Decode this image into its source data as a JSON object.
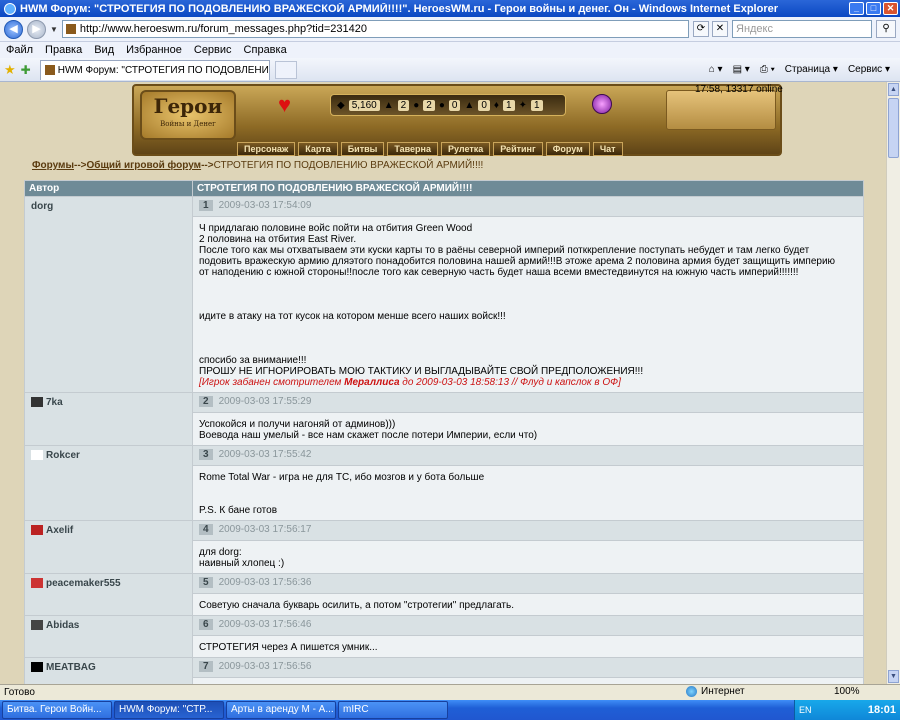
{
  "window": {
    "title": "HWM Форум: \"СТРОТЕГИЯ ПО ПОДОВЛЕНИЮ ВРАЖЕСКОЙ АРМИЙ!!!!\". HeroesWM.ru - Герои войны и денег. Он - Windows Internet Explorer"
  },
  "address": {
    "url": "http://www.heroeswm.ru/forum_messages.php?tid=231420",
    "search_placeholder": "Яндекс"
  },
  "menu": [
    "Файл",
    "Правка",
    "Вид",
    "Избранное",
    "Сервис",
    "Справка"
  ],
  "tab": {
    "title": "HWM Форум: \"СТРОТЕГИЯ ПО ПОДОВЛЕНИЮ ВРАЖ...",
    "cmd_page": "Страница",
    "cmd_tools": "Сервис"
  },
  "game": {
    "logo_main": "Герои",
    "logo_sub": "Войны и Денег",
    "clock": "17:58, 13317 online",
    "resources": [
      "5,160",
      "2",
      "2",
      "0",
      "0",
      "1",
      "1"
    ],
    "nav": [
      "Персонаж",
      "Карта",
      "Битвы",
      "Таверна",
      "Рулетка",
      "Рейтинг",
      "Форум",
      "Чат"
    ]
  },
  "breadcrumb": {
    "root": "Форумы",
    "sep1": "-->",
    "forum": "Общий игровой форум",
    "sep2": "-->",
    "topic": "СТРОТЕГИЯ ПО ПОДОВЛЕНИЮ ВРАЖЕСКОЙ АРМИЙ!!!!"
  },
  "table": {
    "col_author": "Автор",
    "col_topic": "СТРОТЕГИЯ ПО ПОДОВЛЕНИЮ ВРАЖЕСКОЙ АРМИЙ!!!!"
  },
  "posts": [
    {
      "author": "dorg",
      "num": "1",
      "date": "2009-03-03 17:54:09",
      "lines": [
        "Ч придлагаю половине войс пойти на отбития Green Wood",
        "2 половина на отбития East River.",
        "После того как мы отхватываем эти куски карты то в раёны северной империй потккрепление поступать небудет и там легко будет",
        "подовить вражескую армию дляэтого понадобится половина нашей армий!!!В этоже арема 2 половина армия будет защищить империю",
        "от наподению с южной стороны!!после того как северную часть будет наша всеми вместедвинутся на южную часть империй!!!!!!!",
        "",
        "",
        "",
        "идите в атаку на тот кусок на котором менше всего наших войск!!!",
        "",
        "",
        "",
        "спосибо за внимание!!!",
        "ПРОШУ НЕ ИГНОРИРОВАТЬ МОЮ ТАКТИКУ И ВЫГЛАДЫВАЙТЕ СВОЙ ПРЕДПОЛОЖЕНИЯ!!!"
      ],
      "ban_prefix": "[Игрок забанен смотрителем ",
      "ban_mod": "Мераллиса",
      "ban_suffix": " до 2009-03-03 18:58:13 // Флуд и капслок в ОФ]"
    },
    {
      "author": "7ka",
      "num": "2",
      "date": "2009-03-03 17:55:29",
      "lines": [
        "Успокойся и получи нагоняй от админов)))",
        "Воевода наш умелый - все нам скажет после потери Империи, если что)"
      ]
    },
    {
      "author": "Rokcer",
      "num": "3",
      "date": "2009-03-03 17:55:42",
      "lines": [
        "Rome Total War - игра не для ТС, ибо мозгов и у бота больше",
        "",
        "",
        "P.S. К бане готов"
      ]
    },
    {
      "author": "Axelif",
      "num": "4",
      "date": "2009-03-03 17:56:17",
      "lines": [
        "для dorg:",
        "наивный хлопец :)"
      ]
    },
    {
      "author": "peacemaker555",
      "num": "5",
      "date": "2009-03-03 17:56:36",
      "lines": [
        "Советую сначала букварь осилить, а потом \"стротегии\" предлагать."
      ]
    },
    {
      "author": "Abidas",
      "num": "6",
      "date": "2009-03-03 17:56:46",
      "lines": [
        "СТРОТЕГИЯ через А пишется умник..."
      ]
    },
    {
      "author": "MEATBAG",
      "num": "7",
      "date": "2009-03-03 17:56:56",
      "lines": []
    }
  ],
  "status": {
    "text": "Готово",
    "zone": "Интернет",
    "zoom": "100%"
  },
  "taskbar": {
    "tasks": [
      "Битва. Герои Войн...",
      "HWM Форум: \"СТР...",
      "Арты в аренду М - А...",
      "mIRC"
    ],
    "lang": "EN",
    "time": "18:01"
  }
}
